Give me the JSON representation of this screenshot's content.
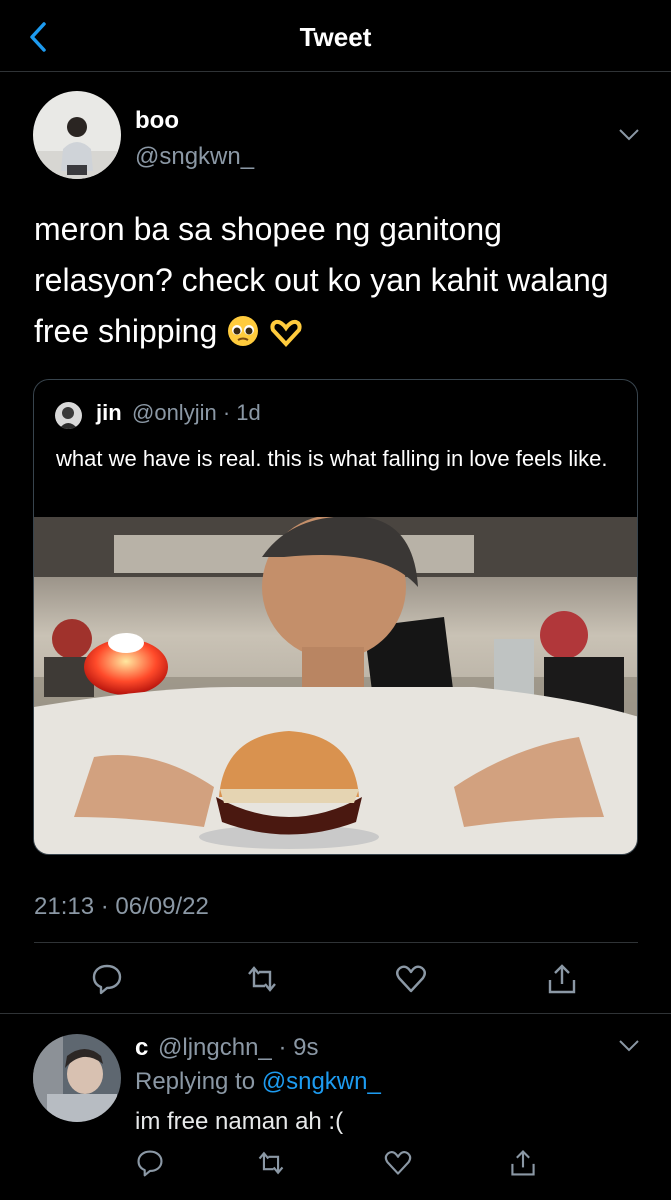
{
  "header": {
    "title": "Tweet"
  },
  "tweet": {
    "name": "boo",
    "handle": "@sngkwn_",
    "text": "meron ba sa shopee ng ganitong relasyon? check out ko yan kahit walang free shipping",
    "timestamp": "21:13 · 06/09/22",
    "quote": {
      "name": "jin",
      "handle": "@onlyjin",
      "age": "· 1d",
      "text": "what we have is real. this is what falling in love feels like."
    }
  },
  "reply": {
    "name": "c",
    "handle": "@ljngchn_",
    "age": "· 9s",
    "replying_prefix": "Replying to",
    "replying_to": "@sngkwn_",
    "text": "im free naman ah :("
  },
  "colors": {
    "accent": "#1d9bf0",
    "muted": "#8b98a5",
    "divider": "#2f3336"
  }
}
